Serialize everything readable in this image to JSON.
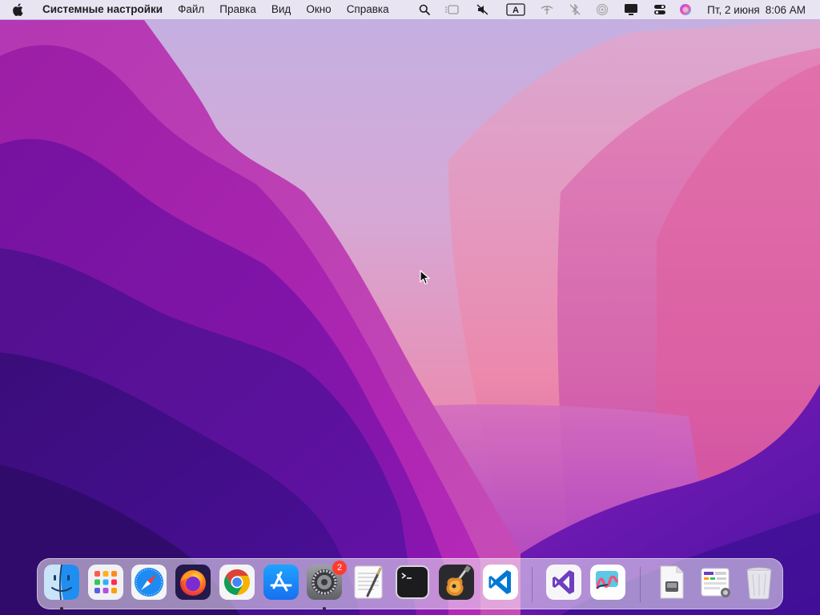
{
  "menubar": {
    "app_name": "Системные настройки",
    "menus": [
      "Файл",
      "Правка",
      "Вид",
      "Окно",
      "Справка"
    ],
    "input_source": "A",
    "date": "Пт, 2 июня",
    "time": "8:06 AM"
  },
  "dock": {
    "system_settings_badge": "2"
  },
  "colors": {
    "badge": "#ff3b30",
    "vscode_blue": "#0078d4",
    "visual_studio_purple": "#6d3fc0"
  }
}
